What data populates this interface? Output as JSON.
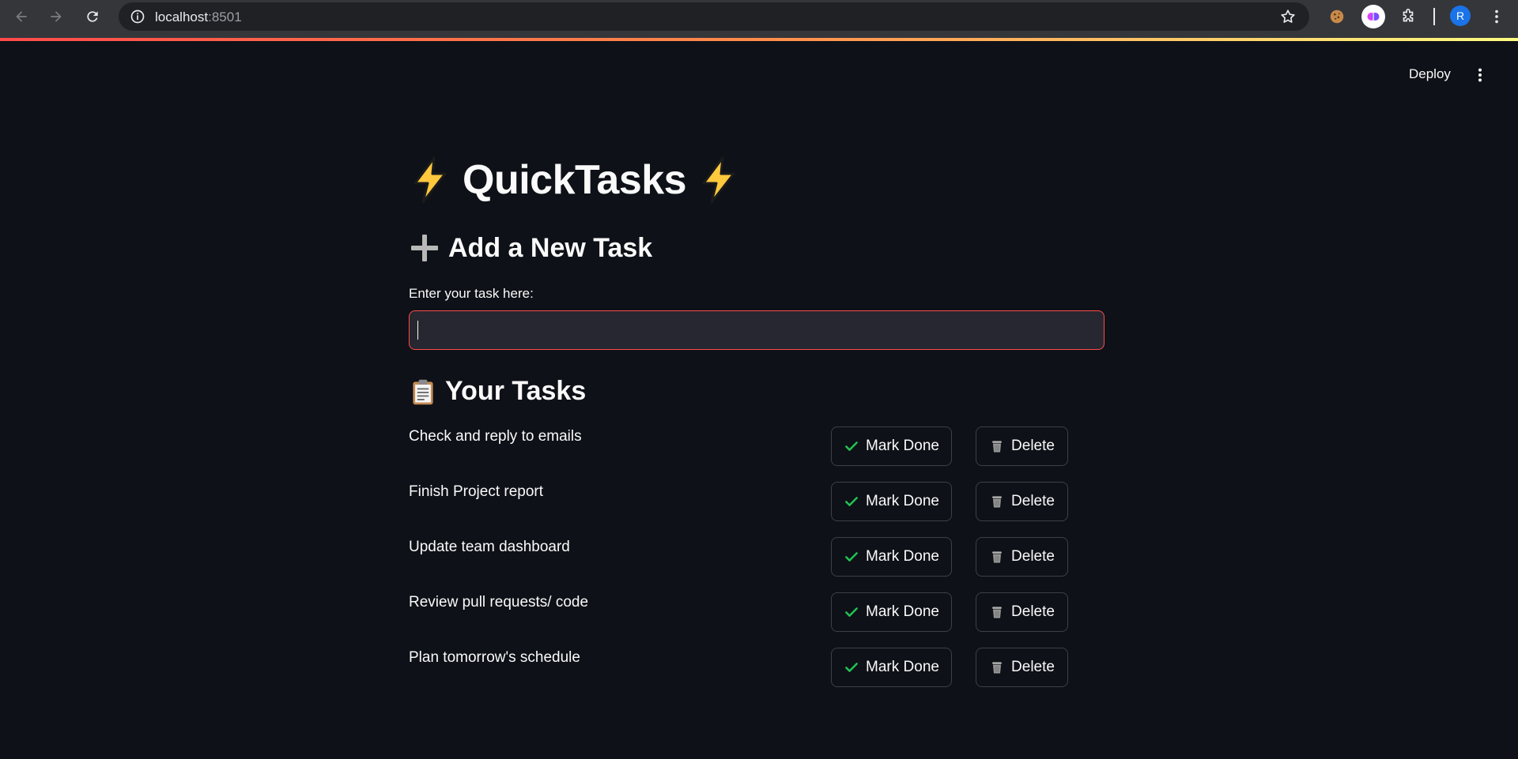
{
  "browser": {
    "url_host": "localhost",
    "url_port": ":8501",
    "profile_initial": "R"
  },
  "app_header": {
    "deploy_label": "Deploy"
  },
  "page": {
    "title": "QuickTasks",
    "title_icon": "lightning-bolt-icon",
    "add_section": {
      "heading": "Add a New Task",
      "icon": "plus-icon",
      "input_label": "Enter your task here:",
      "input_value": "",
      "input_placeholder": ""
    },
    "tasks_section": {
      "heading": "Your Tasks",
      "icon": "clipboard-icon",
      "mark_done_label": "Mark Done",
      "delete_label": "Delete",
      "tasks": [
        {
          "text": "Check and reply to emails"
        },
        {
          "text": "Finish Project report"
        },
        {
          "text": "Update team dashboard"
        },
        {
          "text": "Review pull requests/ code"
        },
        {
          "text": "Plan tomorrow's schedule"
        }
      ]
    }
  },
  "colors": {
    "background": "#0e1117",
    "accent": "#ff4b4b",
    "check_green": "#21c354",
    "input_bg": "#262730"
  }
}
